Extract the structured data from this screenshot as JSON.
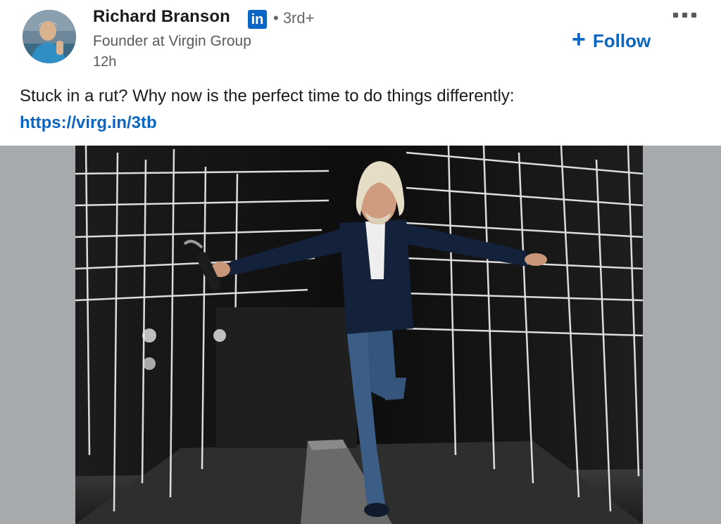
{
  "post": {
    "author": {
      "name": "Richard Branson",
      "network_badge": "in",
      "degree": "• 3rd+",
      "headline": "Founder at Virgin Group",
      "timestamp": "12h"
    },
    "follow_label": "Follow",
    "text": "Stuck in a rut? Why now is the perfect time to do things differently:",
    "link": "https://virg.in/3tb",
    "icons": {
      "more": "more-horizontal-icon",
      "follow": "plus-icon",
      "badge": "linkedin-icon"
    }
  },
  "colors": {
    "accent": "#0a66c2",
    "media_background": "#a7aaad"
  }
}
